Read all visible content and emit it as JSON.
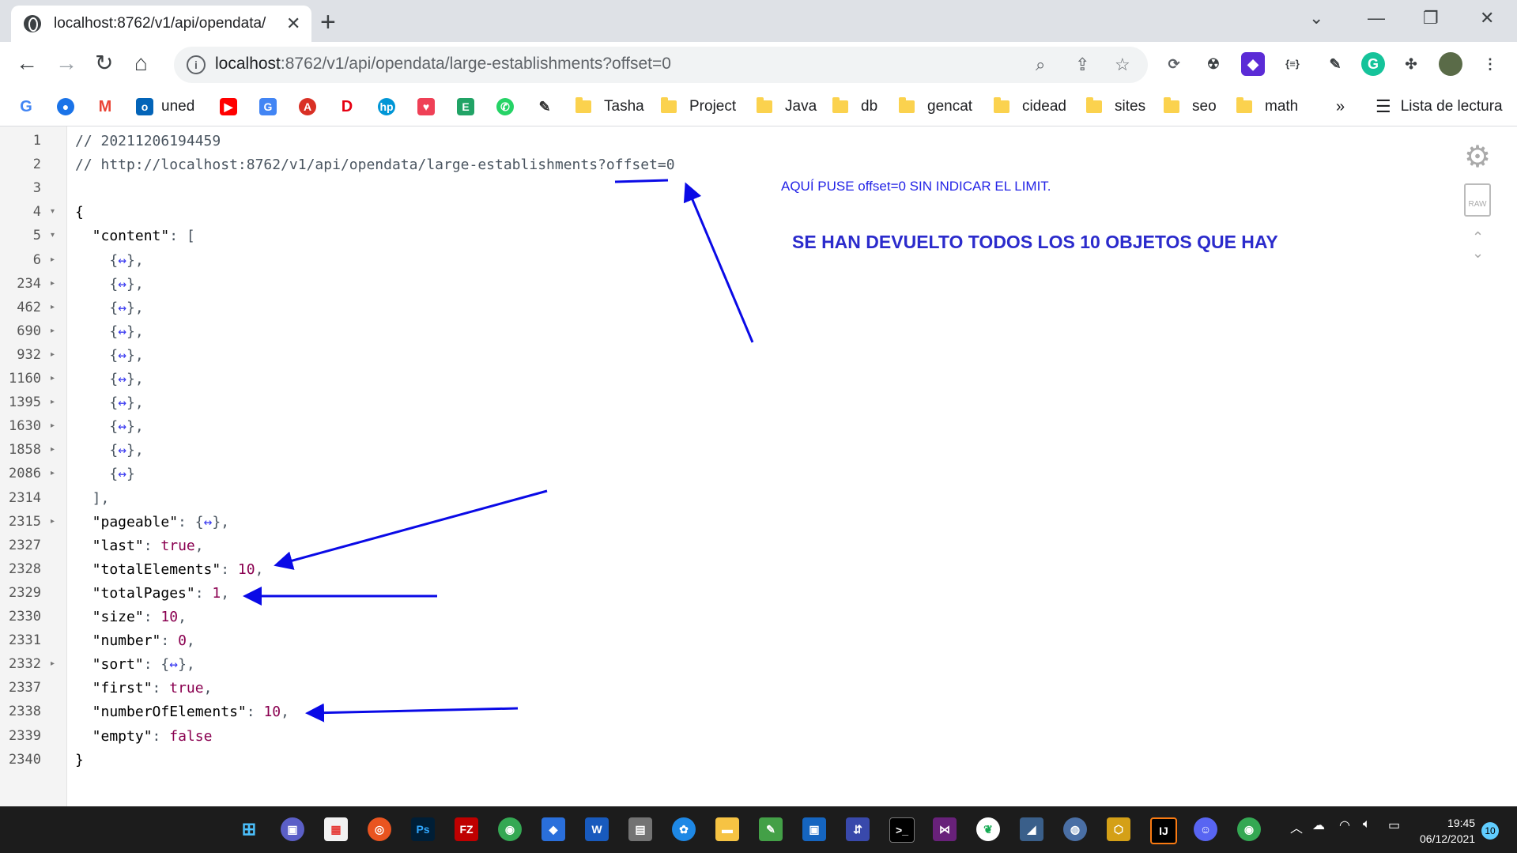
{
  "browser": {
    "tab_title": "localhost:8762/v1/api/opendata/",
    "tab_close": "✕",
    "new_tab": "+",
    "url_host": "localhost",
    "url_path": ":8762/v1/api/opendata/large-establishments?offset=0",
    "window_controls": [
      "⌄",
      "—",
      "❐",
      "✕"
    ],
    "bookmarks": [
      {
        "label": "uned",
        "type": "outlook"
      },
      {
        "label": "Tasha",
        "type": "folder"
      },
      {
        "label": "Project",
        "type": "folder"
      },
      {
        "label": "Java",
        "type": "folder"
      },
      {
        "label": "db",
        "type": "folder"
      },
      {
        "label": "gencat",
        "type": "folder"
      },
      {
        "label": "cidead",
        "type": "folder"
      },
      {
        "label": "sites",
        "type": "folder"
      },
      {
        "label": "seo",
        "type": "folder"
      },
      {
        "label": "math",
        "type": "folder"
      }
    ],
    "bookmarks_more": "»",
    "reading_list": "Lista de lectura"
  },
  "json_view": {
    "lines": [
      {
        "n": "1",
        "segs": [
          [
            "cmt",
            "// 20211206194459"
          ]
        ]
      },
      {
        "n": "2",
        "segs": [
          [
            "cmt",
            "// http://localhost:8762/v1/api/opendata/large-establishments?offset=0"
          ]
        ]
      },
      {
        "n": "3",
        "segs": []
      },
      {
        "n": "4",
        "tri": "▾",
        "segs": [
          [
            "key",
            "{"
          ]
        ]
      },
      {
        "n": "5",
        "tri": "▾",
        "segs": [
          [
            "key",
            "  \"content\""
          ],
          [
            "cmt",
            ": ["
          ]
        ]
      },
      {
        "n": "6",
        "tri": "▸",
        "segs": [
          [
            "cmt",
            "    {"
          ],
          [
            "coll",
            "↔"
          ],
          [
            "cmt",
            "},"
          ]
        ]
      },
      {
        "n": "234",
        "tri": "▸",
        "segs": [
          [
            "cmt",
            "    {"
          ],
          [
            "coll",
            "↔"
          ],
          [
            "cmt",
            "},"
          ]
        ]
      },
      {
        "n": "462",
        "tri": "▸",
        "segs": [
          [
            "cmt",
            "    {"
          ],
          [
            "coll",
            "↔"
          ],
          [
            "cmt",
            "},"
          ]
        ]
      },
      {
        "n": "690",
        "tri": "▸",
        "segs": [
          [
            "cmt",
            "    {"
          ],
          [
            "coll",
            "↔"
          ],
          [
            "cmt",
            "},"
          ]
        ]
      },
      {
        "n": "932",
        "tri": "▸",
        "segs": [
          [
            "cmt",
            "    {"
          ],
          [
            "coll",
            "↔"
          ],
          [
            "cmt",
            "},"
          ]
        ]
      },
      {
        "n": "1160",
        "tri": "▸",
        "segs": [
          [
            "cmt",
            "    {"
          ],
          [
            "coll",
            "↔"
          ],
          [
            "cmt",
            "},"
          ]
        ]
      },
      {
        "n": "1395",
        "tri": "▸",
        "segs": [
          [
            "cmt",
            "    {"
          ],
          [
            "coll",
            "↔"
          ],
          [
            "cmt",
            "},"
          ]
        ]
      },
      {
        "n": "1630",
        "tri": "▸",
        "segs": [
          [
            "cmt",
            "    {"
          ],
          [
            "coll",
            "↔"
          ],
          [
            "cmt",
            "},"
          ]
        ]
      },
      {
        "n": "1858",
        "tri": "▸",
        "segs": [
          [
            "cmt",
            "    {"
          ],
          [
            "coll",
            "↔"
          ],
          [
            "cmt",
            "},"
          ]
        ]
      },
      {
        "n": "2086",
        "tri": "▸",
        "segs": [
          [
            "cmt",
            "    {"
          ],
          [
            "coll",
            "↔"
          ],
          [
            "cmt",
            "}"
          ]
        ]
      },
      {
        "n": "2314",
        "segs": [
          [
            "cmt",
            "  ],"
          ]
        ]
      },
      {
        "n": "2315",
        "tri": "▸",
        "segs": [
          [
            "key",
            "  \"pageable\""
          ],
          [
            "cmt",
            ": {"
          ],
          [
            "coll",
            "↔"
          ],
          [
            "cmt",
            "},"
          ]
        ]
      },
      {
        "n": "2327",
        "segs": [
          [
            "key",
            "  \"last\""
          ],
          [
            "cmt",
            ": "
          ],
          [
            "bool",
            "true"
          ],
          [
            "cmt",
            ","
          ]
        ]
      },
      {
        "n": "2328",
        "segs": [
          [
            "key",
            "  \"totalElements\""
          ],
          [
            "cmt",
            ": "
          ],
          [
            "num",
            "10"
          ],
          [
            "cmt",
            ","
          ]
        ]
      },
      {
        "n": "2329",
        "segs": [
          [
            "key",
            "  \"totalPages\""
          ],
          [
            "cmt",
            ": "
          ],
          [
            "num",
            "1"
          ],
          [
            "cmt",
            ","
          ]
        ]
      },
      {
        "n": "2330",
        "segs": [
          [
            "key",
            "  \"size\""
          ],
          [
            "cmt",
            ": "
          ],
          [
            "num",
            "10"
          ],
          [
            "cmt",
            ","
          ]
        ]
      },
      {
        "n": "2331",
        "segs": [
          [
            "key",
            "  \"number\""
          ],
          [
            "cmt",
            ": "
          ],
          [
            "num",
            "0"
          ],
          [
            "cmt",
            ","
          ]
        ]
      },
      {
        "n": "2332",
        "tri": "▸",
        "segs": [
          [
            "key",
            "  \"sort\""
          ],
          [
            "cmt",
            ": {"
          ],
          [
            "coll",
            "↔"
          ],
          [
            "cmt",
            "},"
          ]
        ]
      },
      {
        "n": "2337",
        "segs": [
          [
            "key",
            "  \"first\""
          ],
          [
            "cmt",
            ": "
          ],
          [
            "bool",
            "true"
          ],
          [
            "cmt",
            ","
          ]
        ]
      },
      {
        "n": "2338",
        "segs": [
          [
            "key",
            "  \"numberOfElements\""
          ],
          [
            "cmt",
            ": "
          ],
          [
            "num",
            "10"
          ],
          [
            "cmt",
            ","
          ]
        ]
      },
      {
        "n": "2339",
        "segs": [
          [
            "key",
            "  \"empty\""
          ],
          [
            "cmt",
            ": "
          ],
          [
            "bool",
            "false"
          ]
        ]
      },
      {
        "n": "2340",
        "segs": [
          [
            "key",
            "}"
          ]
        ]
      }
    ]
  },
  "annotations": {
    "note_small": "AQUÍ PUSE offset=0 SIN INDICAR EL LIMIT.",
    "note_big": "SE HAN DEVUELTO TODOS LOS 10 OBJETOS QUE HAY",
    "arrow_color": "#0a0ae6"
  },
  "taskbar": {
    "time": "19:45",
    "date": "06/12/2021",
    "notifications": "10"
  }
}
